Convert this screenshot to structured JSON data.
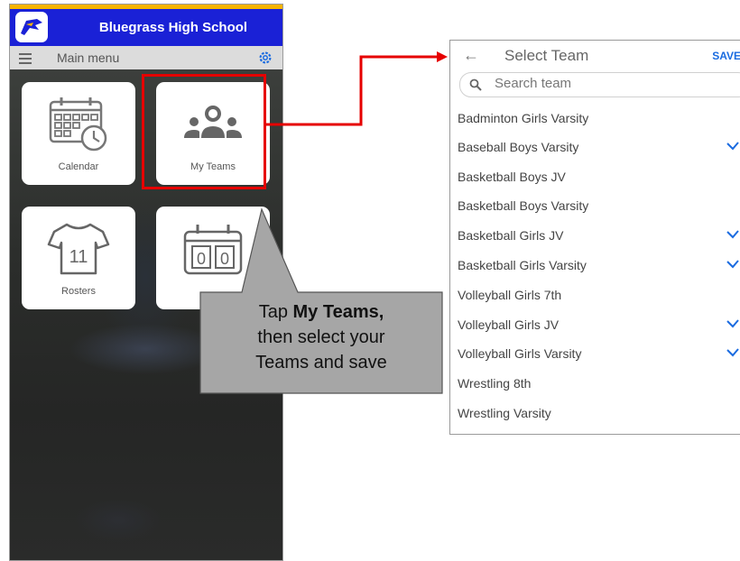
{
  "phone": {
    "app_title": "Bluegrass High School",
    "menu_label": "Main menu",
    "tiles": [
      {
        "label": "Calendar",
        "icon": "calendar-icon"
      },
      {
        "label": "My Teams",
        "icon": "team-icon"
      },
      {
        "label": "Rosters",
        "icon": "jersey-icon"
      },
      {
        "label": "",
        "icon": "scoreboard-icon"
      }
    ],
    "jersey_number": "11",
    "scoreboard_digits": [
      "0",
      "0"
    ]
  },
  "callout": {
    "line1_prefix": "Tap ",
    "line1_bold": "My Teams,",
    "line2": "then select your",
    "line3": "Teams and save"
  },
  "select_team": {
    "title": "Select Team",
    "save_label": "SAVE",
    "search_placeholder": "Search team",
    "teams": [
      {
        "name": "Badminton Girls Varsity",
        "selected": false
      },
      {
        "name": "Baseball Boys Varsity",
        "selected": true
      },
      {
        "name": "Basketball Boys JV",
        "selected": false
      },
      {
        "name": "Basketball Boys Varsity",
        "selected": false
      },
      {
        "name": "Basketball Girls JV",
        "selected": true
      },
      {
        "name": "Basketball Girls Varsity",
        "selected": true
      },
      {
        "name": "Volleyball Girls 7th",
        "selected": false
      },
      {
        "name": "Volleyball Girls JV",
        "selected": true
      },
      {
        "name": "Volleyball Girls Varsity",
        "selected": true
      },
      {
        "name": "Wrestling 8th",
        "selected": false
      },
      {
        "name": "Wrestling Varsity",
        "selected": false
      }
    ]
  },
  "colors": {
    "header_blue": "#1a21d6",
    "accent_gold": "#f5b400",
    "highlight_red": "#e60000",
    "check_blue": "#1a6be0",
    "callout_gray": "#a6a6a6"
  }
}
